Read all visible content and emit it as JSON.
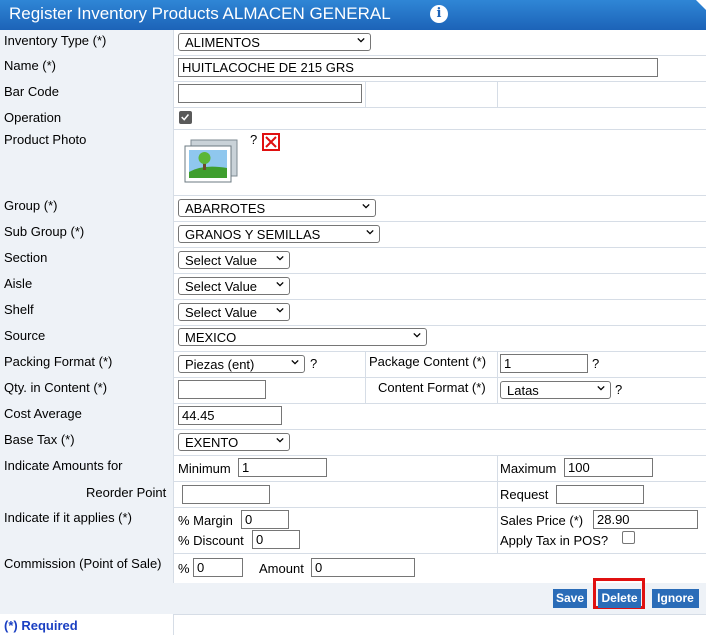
{
  "title": "Register Inventory Products ALMACEN GENERAL",
  "info_icon": "i",
  "fields": {
    "inventory_type": {
      "label": "Inventory Type (*)",
      "value": "ALIMENTOS"
    },
    "name": {
      "label": "Name (*)",
      "value": "HUITLACOCHE DE 215 GRS"
    },
    "bar_code": {
      "label": "Bar Code",
      "value": ""
    },
    "operation": {
      "label": "Operation",
      "checked": true
    },
    "product_photo": {
      "label": "Product Photo",
      "help": "?"
    },
    "group": {
      "label": "Group (*)",
      "value": "ABARROTES"
    },
    "sub_group": {
      "label": "Sub Group (*)",
      "value": "GRANOS Y SEMILLAS"
    },
    "section": {
      "label": "Section",
      "value": "Select Value"
    },
    "aisle": {
      "label": "Aisle",
      "value": "Select Value"
    },
    "shelf": {
      "label": "Shelf",
      "value": "Select Value"
    },
    "source": {
      "label": "Source",
      "value": "MEXICO"
    },
    "packing_format": {
      "label": "Packing Format (*)",
      "value": "Piezas (ent)",
      "help": "?"
    },
    "package_content": {
      "label": "Package Content (*)",
      "value": "1",
      "help": "?"
    },
    "qty_in_content": {
      "label": "Qty. in Content (*)",
      "value": ""
    },
    "content_format": {
      "label": "Content Format (*)",
      "value": "Latas",
      "help": "?"
    },
    "cost_average": {
      "label": "Cost Average",
      "value": "44.45"
    },
    "base_tax": {
      "label": "Base Tax (*)",
      "value": "EXENTO"
    },
    "indicate_amounts": {
      "label": "Indicate Amounts for"
    },
    "minimum": {
      "label": "Minimum",
      "value": "1"
    },
    "maximum": {
      "label": "Maximum",
      "value": "100"
    },
    "reorder_point": {
      "label": "Reorder Point",
      "value": ""
    },
    "request": {
      "label": "Request",
      "value": ""
    },
    "indicate_applies": {
      "label": "Indicate if it applies (*)"
    },
    "margin": {
      "label": "% Margin",
      "value": "0"
    },
    "discount": {
      "label": "% Discount",
      "value": "0"
    },
    "sales_price": {
      "label": "Sales Price (*)",
      "value": "28.90"
    },
    "apply_tax": {
      "label": "Apply Tax in POS?",
      "checked": false
    },
    "commission": {
      "label": "Commission (Point of Sale)"
    },
    "commission_pct": {
      "label": "%",
      "value": "0"
    },
    "amount": {
      "label": "Amount",
      "value": "0"
    }
  },
  "buttons": {
    "save": "Save",
    "delete": "Delete",
    "ignore": "Ignore"
  },
  "footer": {
    "required": "(*) Required"
  },
  "colors": {
    "title_bar": "#1c63b8",
    "button": "#2a6cb8",
    "label_bg": "#eef2f7",
    "highlight": "#e01010",
    "required_text": "#1a3fc2"
  }
}
